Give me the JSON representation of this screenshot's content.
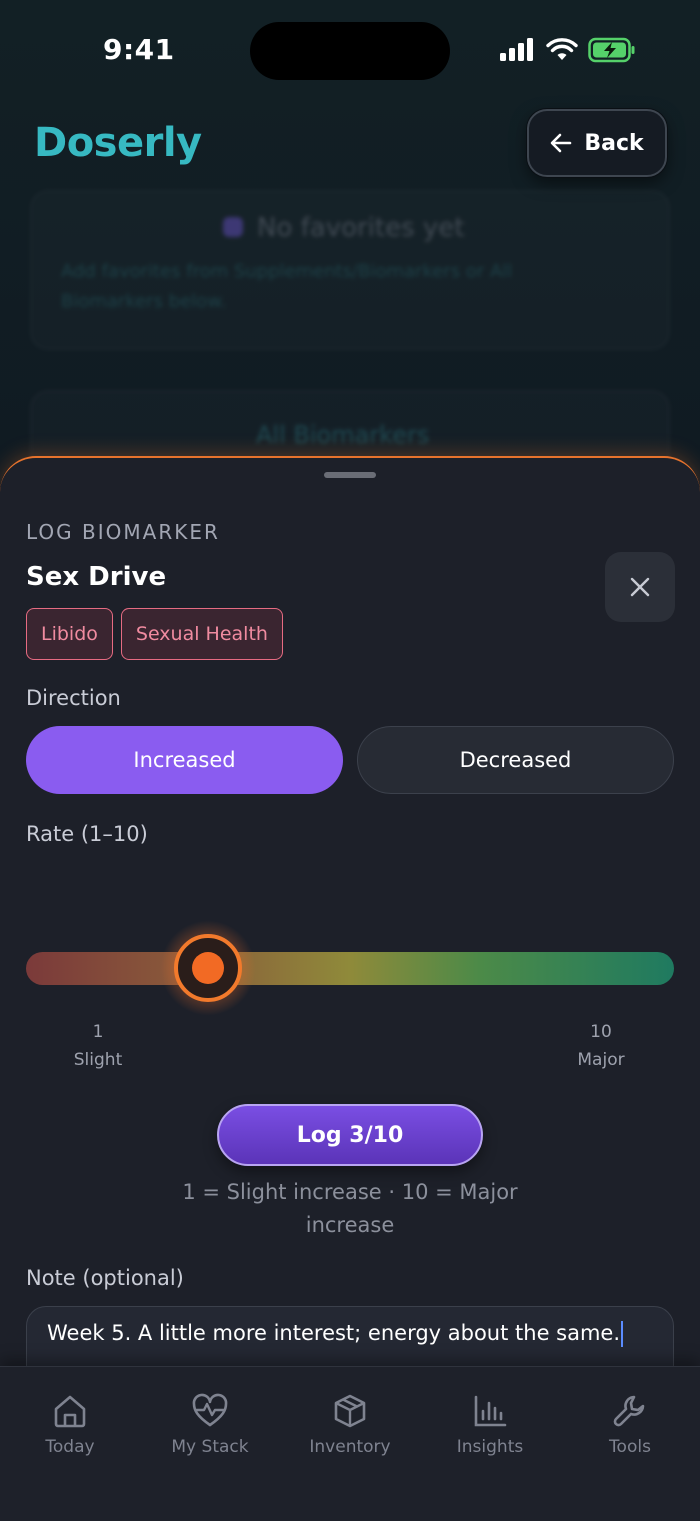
{
  "status_bar": {
    "time": "9:41"
  },
  "header": {
    "app_name": "Doserly",
    "back_label": "Back"
  },
  "background": {
    "favorites_title": "No favorites yet",
    "favorites_line1": "Add favorites from Supplements/Biomarkers or All",
    "favorites_line2": "Biomarkers below.",
    "all_biomarkers": "All Biomarkers"
  },
  "sheet": {
    "eyebrow": "LOG BIOMARKER",
    "title": "Sex Drive",
    "tags": [
      "Libido",
      "Sexual Health"
    ],
    "direction_label": "Direction",
    "direction_options": [
      "Increased",
      "Decreased"
    ],
    "direction_selected": "Increased",
    "rate_label": "Rate (1–10)",
    "rate": {
      "min": 1,
      "max": 10,
      "value": 3,
      "min_caption": "Slight",
      "max_caption": "Major",
      "min_text": "1",
      "max_text": "10"
    },
    "log_button": "Log 3/10",
    "helper_text": "1 = Slight increase · 10 = Major increase",
    "note_label": "Note (optional)",
    "note_value": "Week 5. A little more interest; energy about the same."
  },
  "tabbar": {
    "items": [
      {
        "label": "Today",
        "icon": "home-icon"
      },
      {
        "label": "My Stack",
        "icon": "heart-pulse-icon"
      },
      {
        "label": "Inventory",
        "icon": "box-icon"
      },
      {
        "label": "Insights",
        "icon": "bar-chart-icon"
      },
      {
        "label": "Tools",
        "icon": "wrench-icon"
      }
    ]
  },
  "colors": {
    "accent_purple": "#8a5cf0",
    "accent_orange": "#f26a24",
    "brand_teal": "#37b9c2",
    "tag_pink": "#e66b82"
  }
}
